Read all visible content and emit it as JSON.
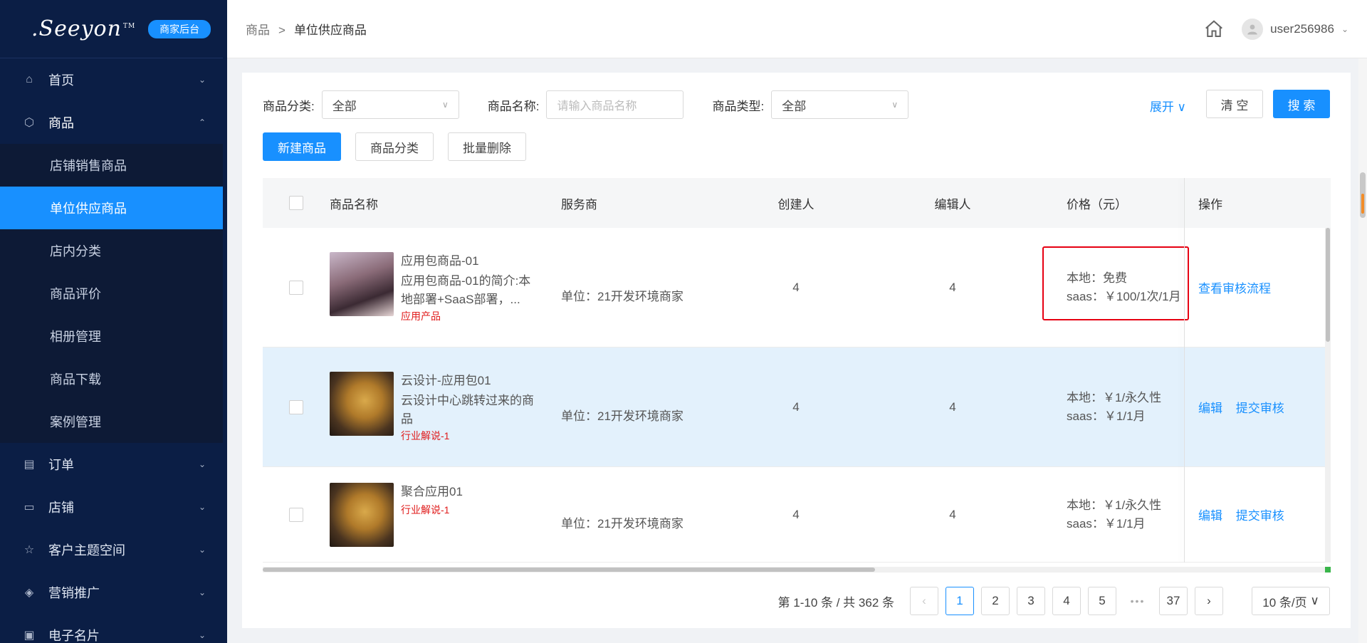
{
  "brand": {
    "logo": ".Seeyon",
    "tm": "TM",
    "badge": "商家后台"
  },
  "sidebar": {
    "items": [
      {
        "label": "首页",
        "icon": "home-icon",
        "open": false
      },
      {
        "label": "商品",
        "icon": "cube-icon",
        "open": true,
        "children": [
          "店铺销售商品",
          "单位供应商品",
          "店内分类",
          "商品评价",
          "相册管理",
          "商品下载",
          "案例管理"
        ],
        "active_child": "单位供应商品"
      },
      {
        "label": "订单",
        "icon": "document-icon",
        "open": false
      },
      {
        "label": "店铺",
        "icon": "store-icon",
        "open": false
      },
      {
        "label": "客户主题空间",
        "icon": "star-icon",
        "open": false
      },
      {
        "label": "营销推广",
        "icon": "layers-icon",
        "open": false
      },
      {
        "label": "电子名片",
        "icon": "id-card-icon",
        "open": false
      }
    ]
  },
  "header": {
    "breadcrumb": [
      "商品",
      "单位供应商品"
    ],
    "breadcrumb_sep": ">",
    "username": "user256986"
  },
  "filters": {
    "category_label": "商品分类:",
    "category_value": "全部",
    "name_label": "商品名称:",
    "name_placeholder": "请输入商品名称",
    "type_label": "商品类型:",
    "type_value": "全部",
    "expand": "展开",
    "clear": "清 空",
    "search": "搜 索"
  },
  "actions": {
    "new": "新建商品",
    "category": "商品分类",
    "batch_delete": "批量删除"
  },
  "table": {
    "columns": [
      "商品名称",
      "服务商",
      "创建人",
      "编辑人",
      "价格（元）",
      "操作"
    ],
    "rows": [
      {
        "title": "应用包商品-01",
        "desc": "应用包商品-01的简介:本地部署+SaaS部署，...",
        "tag": "应用产品",
        "thumb": "anime-girl-thumbnail",
        "service": "单位：21开发环境商家",
        "creator": "4",
        "editor": "4",
        "price_local": "本地：免费",
        "price_saas": "saas：￥100/1次/1月",
        "ops": [
          "查看审核流程"
        ],
        "highlight": false,
        "boxed_price": true
      },
      {
        "title": "云设计-应用包01",
        "desc": "云设计中心跳转过来的商品",
        "tag": "行业解说-1",
        "thumb": "bear-thumbnail",
        "service": "单位：21开发环境商家",
        "creator": "4",
        "editor": "4",
        "price_local": "本地：￥1/永久性",
        "price_saas": "saas：￥1/1月",
        "ops": [
          "编辑",
          "提交审核"
        ],
        "highlight": true,
        "boxed_price": false
      },
      {
        "title": "聚合应用01",
        "desc": "",
        "tag": "行业解说-1",
        "thumb": "bear-thumbnail",
        "service": "单位：21开发环境商家",
        "creator": "4",
        "editor": "4",
        "price_local": "本地：￥1/永久性",
        "price_saas": "saas：￥1/1月",
        "ops": [
          "编辑",
          "提交审核"
        ],
        "highlight": false,
        "boxed_price": false
      }
    ]
  },
  "pagination": {
    "total": "第 1-10 条 / 共 362 条",
    "pages": [
      "1",
      "2",
      "3",
      "4",
      "5"
    ],
    "last": "37",
    "current": "1",
    "ellipsis": "•••",
    "page_size": "10 条/页"
  },
  "colors": {
    "sidebar_bg": "#0b1e45",
    "accent": "#1890ff",
    "highlight_row": "#e3f1fc",
    "tag_red": "#e01b1b",
    "box_red": "#e60012"
  }
}
